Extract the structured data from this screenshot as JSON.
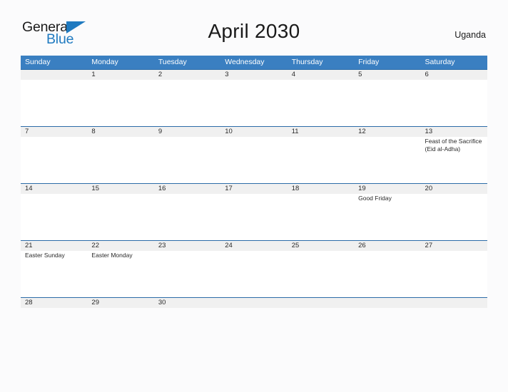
{
  "logo": {
    "word_one": "General",
    "word_two": "Blue",
    "triangle_color": "#1f7ac0"
  },
  "header": {
    "title": "April 2030",
    "country": "Uganda"
  },
  "theme": {
    "header_blue": "#3a7fc1",
    "rule_blue": "#2c6ca8",
    "date_band_gray": "#f0f0f0",
    "page_background": "#fbfbfc"
  },
  "calendar": {
    "day_names": [
      "Sunday",
      "Monday",
      "Tuesday",
      "Wednesday",
      "Thursday",
      "Friday",
      "Saturday"
    ],
    "weeks": [
      [
        {
          "day": ""
        },
        {
          "day": "1",
          "events": []
        },
        {
          "day": "2",
          "events": []
        },
        {
          "day": "3",
          "events": []
        },
        {
          "day": "4",
          "events": []
        },
        {
          "day": "5",
          "events": []
        },
        {
          "day": "6",
          "events": []
        }
      ],
      [
        {
          "day": "7",
          "events": []
        },
        {
          "day": "8",
          "events": []
        },
        {
          "day": "9",
          "events": []
        },
        {
          "day": "10",
          "events": []
        },
        {
          "day": "11",
          "events": []
        },
        {
          "day": "12",
          "events": []
        },
        {
          "day": "13",
          "events": [
            "Feast of the Sacrifice (Eid al-Adha)"
          ]
        }
      ],
      [
        {
          "day": "14",
          "events": []
        },
        {
          "day": "15",
          "events": []
        },
        {
          "day": "16",
          "events": []
        },
        {
          "day": "17",
          "events": []
        },
        {
          "day": "18",
          "events": []
        },
        {
          "day": "19",
          "events": [
            "Good Friday"
          ]
        },
        {
          "day": "20",
          "events": []
        }
      ],
      [
        {
          "day": "21",
          "events": [
            "Easter Sunday"
          ]
        },
        {
          "day": "22",
          "events": [
            "Easter Monday"
          ]
        },
        {
          "day": "23",
          "events": []
        },
        {
          "day": "24",
          "events": []
        },
        {
          "day": "25",
          "events": []
        },
        {
          "day": "26",
          "events": []
        },
        {
          "day": "27",
          "events": []
        }
      ],
      [
        {
          "day": "28",
          "events": []
        },
        {
          "day": "29",
          "events": []
        },
        {
          "day": "30",
          "events": []
        },
        {
          "day": ""
        },
        {
          "day": ""
        },
        {
          "day": ""
        },
        {
          "day": ""
        }
      ]
    ]
  }
}
